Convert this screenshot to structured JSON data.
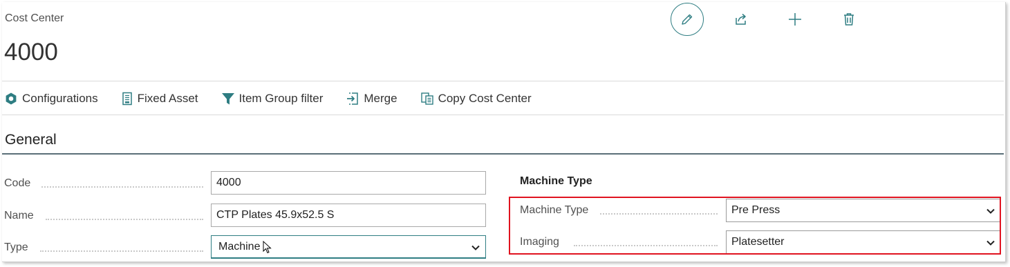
{
  "header": {
    "caption": "Cost Center",
    "title": "4000",
    "actions": [
      {
        "name": "edit",
        "icon": "pencil-icon"
      },
      {
        "name": "share",
        "icon": "share-icon"
      },
      {
        "name": "new",
        "icon": "plus-icon"
      },
      {
        "name": "delete",
        "icon": "trash-icon"
      }
    ]
  },
  "action_bar": {
    "items": [
      {
        "label": "Configurations",
        "icon": "gear-icon"
      },
      {
        "label": "Fixed Asset",
        "icon": "document-icon"
      },
      {
        "label": "Item Group filter",
        "icon": "filter-icon"
      },
      {
        "label": "Merge",
        "icon": "merge-icon"
      },
      {
        "label": "Copy Cost Center",
        "icon": "copy-icon"
      }
    ]
  },
  "general": {
    "title": "General",
    "code": {
      "label": "Code",
      "value": "4000"
    },
    "name": {
      "label": "Name",
      "value": "CTP Plates 45.9x52.5 S"
    },
    "type": {
      "label": "Type",
      "value": "Machine"
    }
  },
  "machine_type": {
    "heading": "Machine Type",
    "machine_type": {
      "label": "Machine Type",
      "value": "Pre Press"
    },
    "imaging": {
      "label": "Imaging",
      "value": "Platesetter"
    }
  },
  "colors": {
    "accent": "#2e7d82",
    "highlight": "#e0121f",
    "group_rule": "#5a6e78"
  }
}
